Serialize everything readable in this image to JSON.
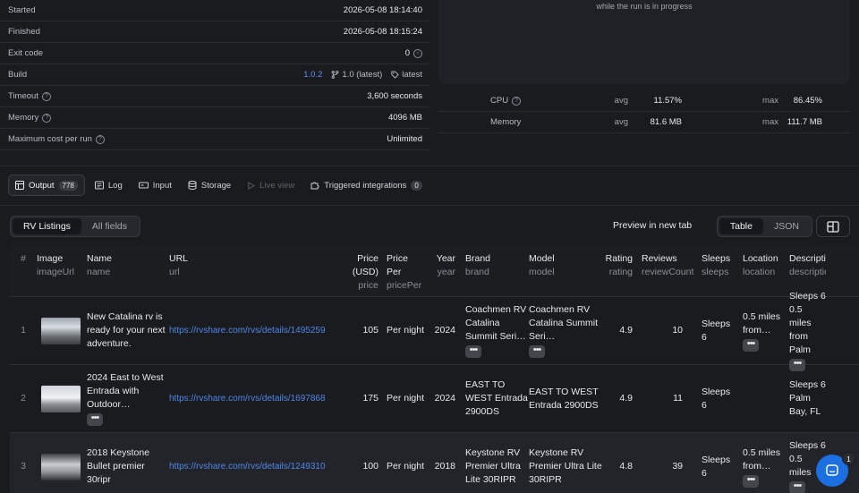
{
  "stats": [
    {
      "label": "Started",
      "value": "2026-05-08 18:14:40"
    },
    {
      "label": "Finished",
      "value": "2026-05-08 18:15:24"
    },
    {
      "label": "Exit code",
      "value": "0"
    },
    {
      "label": "Build",
      "value": "1.0.2",
      "tag": "1.0 (latest)",
      "label2": "latest"
    },
    {
      "label": "Timeout",
      "value": "3,600 seconds"
    },
    {
      "label": "Memory",
      "value": "4096 MB"
    },
    {
      "label": "Maximum cost per run",
      "value": "Unlimited"
    }
  ],
  "panel_text": "while the run is in progress",
  "usage": [
    {
      "name": "CPU",
      "avg_label": "avg",
      "avg": "11.57%",
      "max_label": "max",
      "max": "86.45%"
    },
    {
      "name": "Memory",
      "avg_label": "avg",
      "avg": "81.6 MB",
      "max_label": "max",
      "max": "111.7 MB"
    }
  ],
  "tabs": [
    {
      "label": "Output",
      "badge": "778"
    },
    {
      "label": "Log"
    },
    {
      "label": "Input"
    },
    {
      "label": "Storage"
    },
    {
      "label": "Live view"
    },
    {
      "label": "Triggered integrations",
      "badge": "0"
    }
  ],
  "view_toggle": [
    "RV Listings",
    "All fields"
  ],
  "preview_label": "Preview in new tab",
  "format_toggle": [
    "Table",
    "JSON"
  ],
  "columns": [
    {
      "title": "#",
      "sub": ""
    },
    {
      "title": "Image",
      "sub": "imageUrl"
    },
    {
      "title": "Name",
      "sub": "name"
    },
    {
      "title": "URL",
      "sub": "url"
    },
    {
      "title": "Price (USD)",
      "sub": "price"
    },
    {
      "title": "Price Per",
      "sub": "pricePer"
    },
    {
      "title": "Year",
      "sub": "year"
    },
    {
      "title": "Brand",
      "sub": "brand"
    },
    {
      "title": "Model",
      "sub": "model"
    },
    {
      "title": "Rating",
      "sub": "rating"
    },
    {
      "title": "Reviews",
      "sub": "reviewCount"
    },
    {
      "title": "Sleeps",
      "sub": "sleeps"
    },
    {
      "title": "Location",
      "sub": "location"
    },
    {
      "title": "Description",
      "sub": "description"
    }
  ],
  "rows": [
    {
      "idx": "1",
      "name": "New Catalina rv is ready for your next adventure.",
      "url": "https://rvshare.com/rvs/details/1495259",
      "price": "105",
      "per": "Per night",
      "year": "2024",
      "brand": "Coachmen RV Catalina Summit Seri…",
      "model": "Coachmen RV Catalina Summit Seri…",
      "rating": "4.9",
      "reviews": "10",
      "sleeps": "Sleeps 6",
      "location": "0.5 miles from…",
      "desc": "Sleeps 6 0.5 miles from Palm"
    },
    {
      "idx": "2",
      "name": "2024 East to West Entrada with Outdoor…",
      "url": "https://rvshare.com/rvs/details/1697868",
      "price": "175",
      "per": "Per night",
      "year": "2024",
      "brand": "EAST TO WEST Entrada 2900DS",
      "model": "EAST TO WEST Entrada 2900DS",
      "rating": "4.9",
      "reviews": "11",
      "sleeps": "Sleeps 6",
      "location": "",
      "desc": "Sleeps 6 Palm Bay, FL"
    },
    {
      "idx": "3",
      "name": "2018 Keystone Bullet premier 30ripr",
      "url": "https://rvshare.com/rvs/details/1249310",
      "price": "100",
      "per": "Per night",
      "year": "2018",
      "brand": "Keystone RV Premier Ultra Lite 30RIPR",
      "model": "Keystone RV Premier Ultra Lite 30RIPR",
      "rating": "4.8",
      "reviews": "39",
      "sleeps": "Sleeps 6",
      "location": "0.5 miles from…",
      "desc": "Sleeps 6 0.5 miles"
    }
  ],
  "chat_badge": "1"
}
